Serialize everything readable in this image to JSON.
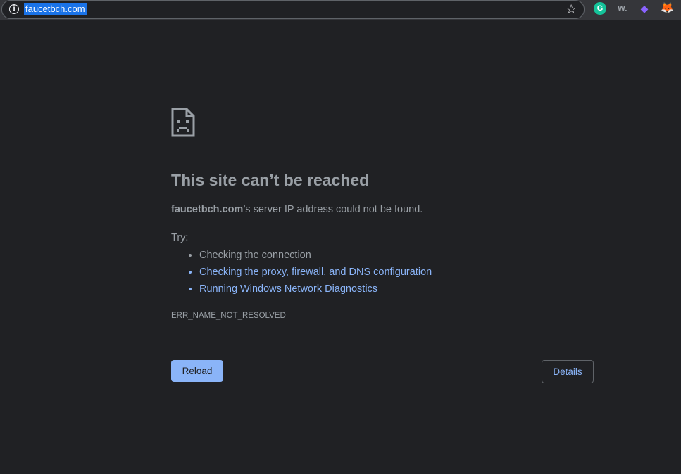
{
  "browser": {
    "url": "faucetbch.com",
    "info_icon": "info-icon",
    "star_icon": "bookmark-star-icon",
    "extensions": [
      {
        "name": "grammarly-icon",
        "glyph": "G"
      },
      {
        "name": "w-extension-icon",
        "glyph": "w."
      },
      {
        "name": "gem-extension-icon",
        "glyph": "◆"
      },
      {
        "name": "metamask-icon",
        "glyph": "🦊"
      }
    ]
  },
  "error_page": {
    "heading": "This site can’t be reached",
    "domain": "faucetbch.com",
    "message": "’s server IP address could not be found.",
    "try_label": "Try:",
    "suggestions": [
      "Checking the connection",
      "Checking the proxy, firewall, and DNS configuration",
      "Running Windows Network Diagnostics"
    ],
    "error_code": "ERR_NAME_NOT_RESOLVED",
    "reload_label": "Reload",
    "details_label": "Details"
  },
  "colors": {
    "background": "#202124",
    "text": "#9aa0a6",
    "link": "#8ab4f8",
    "button": "#8ab4f8"
  }
}
